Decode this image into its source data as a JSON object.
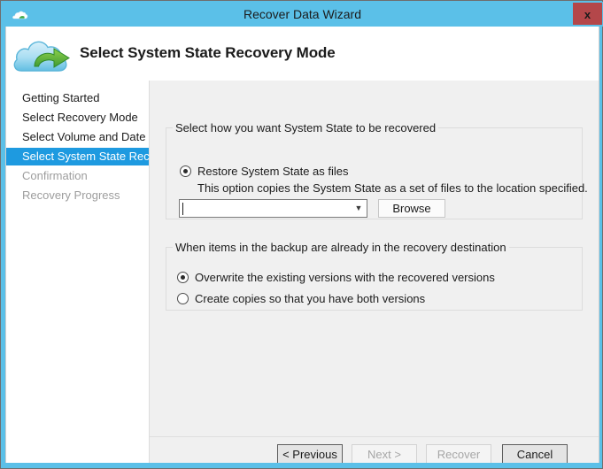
{
  "window": {
    "title": "Recover Data Wizard",
    "title_icon": "cloud-icon",
    "close_label": "x",
    "frame_color": "#5bc0e8",
    "close_color": "#b4474a"
  },
  "header": {
    "title": "Select System State Recovery Mode",
    "icon": "cloud-restore-arrow-icon"
  },
  "sidebar": {
    "items": [
      {
        "label": "Getting Started",
        "state": "normal"
      },
      {
        "label": "Select Recovery Mode",
        "state": "normal"
      },
      {
        "label": "Select Volume and Date",
        "state": "normal"
      },
      {
        "label": "Select System State Reco...",
        "state": "selected"
      },
      {
        "label": "Confirmation",
        "state": "disabled"
      },
      {
        "label": "Recovery Progress",
        "state": "disabled"
      }
    ],
    "highlight_color": "#1e9ae0"
  },
  "main": {
    "recovery_mode_group": {
      "legend": "Select how you want System State to be recovered",
      "option": {
        "label": "Restore System State as files",
        "checked": true
      },
      "description": "This option copies the System State as a set of files to the location specified.",
      "path_combobox": {
        "value": "",
        "placeholder": "",
        "arrow_icon": "chevron-down-icon"
      },
      "browse_button": "Browse"
    },
    "conflict_group": {
      "legend": "When items in the backup are already in the recovery destination",
      "options": [
        {
          "label": "Overwrite the existing versions with the recovered versions",
          "checked": true
        },
        {
          "label": "Create copies so that you have both versions",
          "checked": false
        }
      ]
    }
  },
  "footer": {
    "buttons": [
      {
        "label": "< Previous",
        "enabled": true
      },
      {
        "label": "Next >",
        "enabled": false
      },
      {
        "label": "Recover",
        "enabled": false
      },
      {
        "label": "Cancel",
        "enabled": true
      }
    ]
  }
}
